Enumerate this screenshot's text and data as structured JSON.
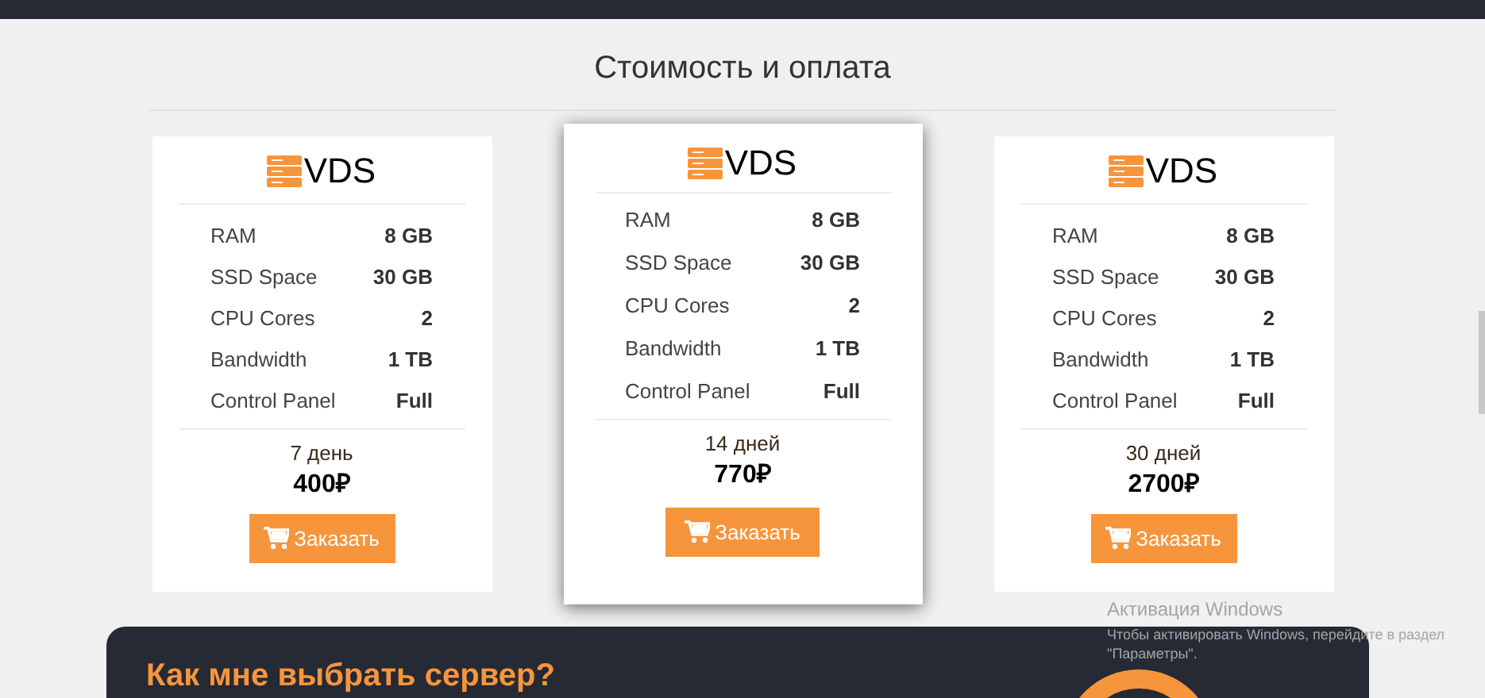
{
  "section_title": "Стоимость и оплата",
  "plans": [
    {
      "name": "VDS",
      "featured": false,
      "specs": [
        {
          "label": "RAM",
          "value": "8 GB"
        },
        {
          "label": "SSD Space",
          "value": "30 GB"
        },
        {
          "label": "CPU Cores",
          "value": "2"
        },
        {
          "label": "Bandwidth",
          "value": "1 TB"
        },
        {
          "label": "Control Panel",
          "value": "Full"
        }
      ],
      "period": "7 день",
      "price": "400₽",
      "button": "Заказать"
    },
    {
      "name": "VDS",
      "featured": true,
      "specs": [
        {
          "label": "RAM",
          "value": "8 GB"
        },
        {
          "label": "SSD Space",
          "value": "30 GB"
        },
        {
          "label": "CPU Cores",
          "value": "2"
        },
        {
          "label": "Bandwidth",
          "value": "1 TB"
        },
        {
          "label": "Control Panel",
          "value": "Full"
        }
      ],
      "period": "14 дней",
      "price": "770₽",
      "button": "Заказать"
    },
    {
      "name": "VDS",
      "featured": false,
      "specs": [
        {
          "label": "RAM",
          "value": "8 GB"
        },
        {
          "label": "SSD Space",
          "value": "30 GB"
        },
        {
          "label": "CPU Cores",
          "value": "2"
        },
        {
          "label": "Bandwidth",
          "value": "1 TB"
        },
        {
          "label": "Control Panel",
          "value": "Full"
        }
      ],
      "period": "30 дней",
      "price": "2700₽",
      "button": "Заказать"
    }
  ],
  "faq_banner": {
    "title": "Как мне выбрать сервер?"
  },
  "activation_notice": {
    "title": "Активация Windows",
    "text": "Чтобы активировать Windows, перейдите в раздел \"Параметры\"."
  }
}
